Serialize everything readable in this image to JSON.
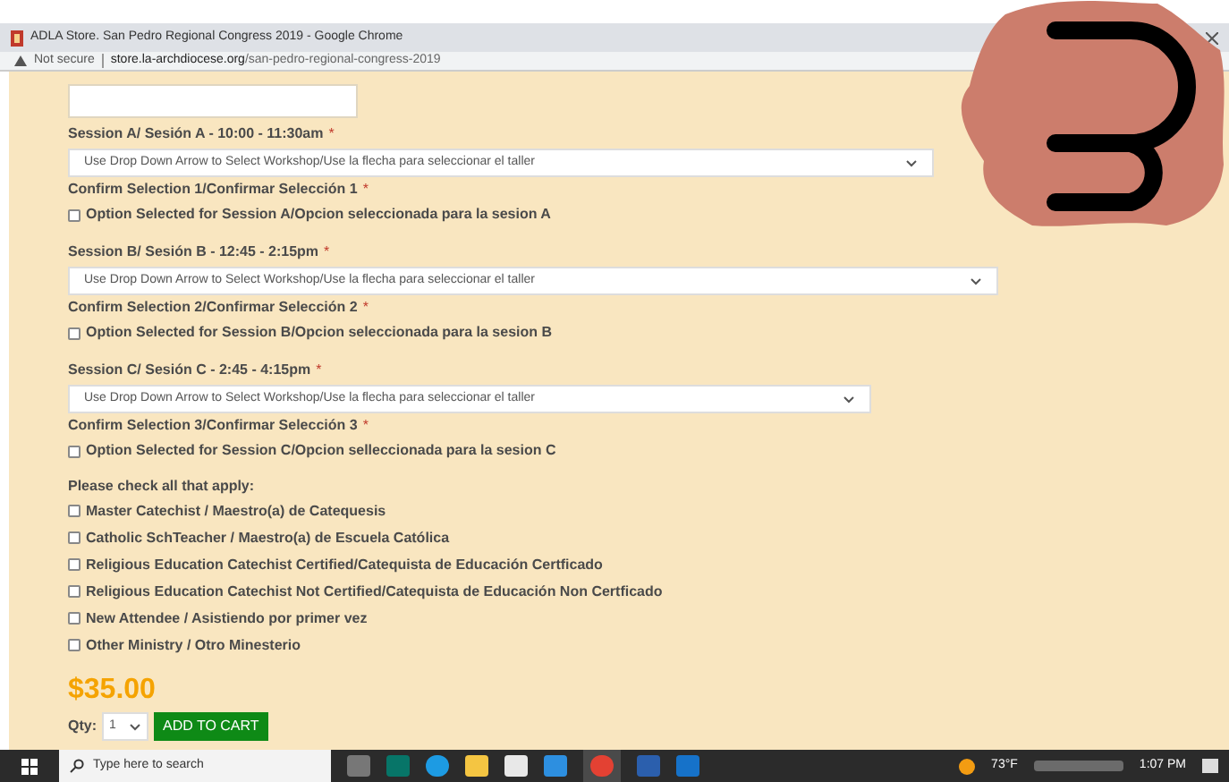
{
  "window": {
    "title": "ADLA Store. San Pedro Regional Congress 2019 - Google Chrome"
  },
  "address_bar": {
    "security": "Not secure",
    "domain": "store.la-archdiocese.org",
    "path": "/san-pedro-regional-congress-2019"
  },
  "sessions": [
    {
      "label": "Session A/ Sesión A - 10:00 - 11:30am",
      "required_mark": "*",
      "select_value": "Use Drop Down Arrow to Select Workshop/Use la flecha para seleccionar el taller",
      "confirm_label": "Confirm Selection 1/Confirmar Selección 1",
      "confirm_required_mark": "*",
      "option": {
        "label": "Option Selected for Session A/Opcion seleccionada para la sesion A",
        "checked": false
      }
    },
    {
      "label": "Session B/ Sesión B - 12:45 - 2:15pm",
      "required_mark": "*",
      "select_value": "Use Drop Down Arrow to Select Workshop/Use la flecha para seleccionar el taller",
      "confirm_label": "Confirm Selection 2/Confirmar Selección 2",
      "confirm_required_mark": "*",
      "option": {
        "label": "Option Selected for Session B/Opcion seleccionada para la sesion B",
        "checked": false
      }
    },
    {
      "label": "Session C/ Sesión C - 2:45 - 4:15pm",
      "required_mark": "*",
      "select_value": "Use Drop Down Arrow to Select Workshop/Use la flecha para seleccionar el taller",
      "confirm_label": "Confirm Selection 3/Confirmar Selección 3",
      "confirm_required_mark": "*",
      "option": {
        "label": "Option Selected for Session C/Opcion selleccionada para la sesion C",
        "checked": false
      }
    }
  ],
  "checklist": {
    "title": "Please check all that apply:",
    "items": [
      {
        "label": "Master Catechist / Maestro(a) de Catequesis",
        "checked": false
      },
      {
        "label": "Catholic SchTeacher / Maestro(a) de Escuela Católica",
        "checked": false
      },
      {
        "label": "Religious Education Catechist Certified/Catequista de Educación Certficado",
        "checked": false
      },
      {
        "label": "Religious Education Catechist Not Certified/Catequista de Educación Non Certficado",
        "checked": false
      },
      {
        "label": "New Attendee / Asistiendo por primer vez",
        "checked": false
      },
      {
        "label": "Other Ministry / Otro Minesterio",
        "checked": false
      }
    ]
  },
  "price": "$35.00",
  "quantity": {
    "label": "Qty:",
    "value": "1"
  },
  "add_to_cart": "ADD TO CART",
  "taskbar": {
    "search_placeholder": "Type here to search",
    "weather": "73°F",
    "time": "1:07 PM"
  }
}
